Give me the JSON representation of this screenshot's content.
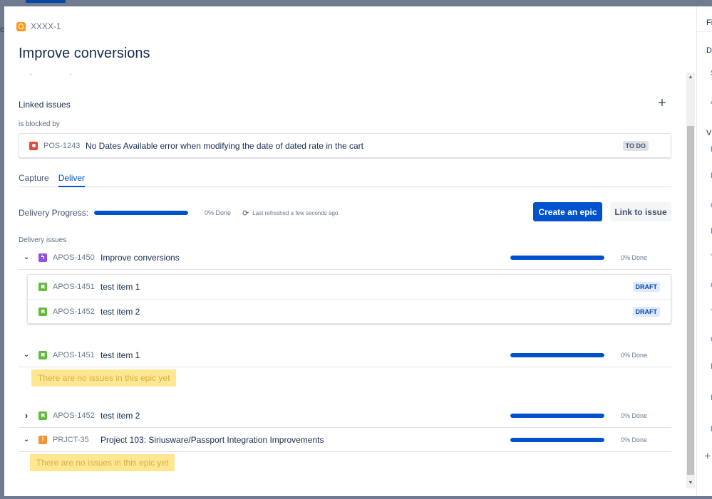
{
  "background": {
    "left_text": "c"
  },
  "issue": {
    "key": "XXXX-1",
    "title": "Improve conversions"
  },
  "linked_issues": {
    "heading": "Linked issues",
    "add_icon": "+",
    "relation": "is blocked by",
    "items": [
      {
        "key": "POS-1243",
        "summary": "No Dates Available error when modifying the date of dated rate in the cart",
        "status": "TO DO",
        "icon": "bug-icon"
      }
    ]
  },
  "tabs": [
    {
      "label": "Capture",
      "active": false
    },
    {
      "label": "Deliver",
      "active": true
    }
  ],
  "delivery": {
    "progress_label": "Delivery Progress:",
    "progress_percent": 0,
    "done_text": "0% Done",
    "refresh_icon": "⟳",
    "refreshed_text": "Last refreshed a few seconds ago",
    "create_epic_label": "Create an epic",
    "link_issue_label": "Link to issue",
    "issues_label": "Delivery issues"
  },
  "epics": [
    {
      "key": "APOS-1450",
      "summary": "Improve conversions",
      "icon": "epic-icon",
      "icon_glyph": "ϟ",
      "expanded": true,
      "chevron": "⌄",
      "progress_percent": 0,
      "done_text": "0% Done",
      "children": [
        {
          "key": "APOS-1451",
          "summary": "test item 1",
          "status": "DRAFT"
        },
        {
          "key": "APOS-1452",
          "summary": "test item 2",
          "status": "DRAFT"
        }
      ]
    },
    {
      "key": "APOS-1451",
      "summary": "test item 1",
      "icon": "story-icon",
      "expanded": true,
      "chevron": "⌄",
      "progress_percent": 0,
      "done_text": "0% Done",
      "empty_text": "There are no issues in this epic yet"
    },
    {
      "key": "APOS-1452",
      "summary": "test item 2",
      "icon": "story-icon",
      "expanded": false,
      "chevron": "›",
      "progress_percent": 0,
      "done_text": "0% Done"
    },
    {
      "key": "PRJCT-35",
      "summary": "Project 103: Siriusware/Passport Integration Improvements",
      "icon": "warning-icon",
      "icon_glyph": "!",
      "expanded": true,
      "chevron": "⌄",
      "progress_percent": 0,
      "done_text": "0% Done",
      "empty_text": "There are no issues in this epic yet"
    }
  ],
  "right_panel": {
    "items": [
      "Fi",
      "DE",
      "S",
      "A",
      "VI",
      "D",
      "L",
      "C",
      "P",
      "T",
      "C",
      "T",
      "C",
      "B",
      "E",
      "R",
      "+"
    ]
  },
  "scrollbar": {
    "up": "▲",
    "down": "▼"
  }
}
